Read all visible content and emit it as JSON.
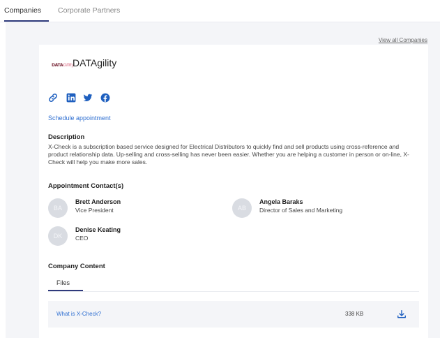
{
  "tabs": {
    "companies": "Companies",
    "corporate_partners": "Corporate Partners",
    "active": "Companies"
  },
  "view_all_link": "View all Companies",
  "company": {
    "logo_text": "DATA",
    "logo_swoosh": "Gility",
    "name": "DATAgility",
    "social_icons": [
      "link-icon",
      "linkedin-icon",
      "twitter-icon",
      "facebook-icon"
    ],
    "schedule_link": "Schedule appointment"
  },
  "description": {
    "title": "Description",
    "text": "X-Check is a subscription based service designed for Electrical Distributors to quickly find and sell products using cross-reference and product relationship data. Up-selling and cross-selling has never been easier. Whether you are helping a customer in person or on-line, X-Check will help you make more sales."
  },
  "contacts": {
    "title": "Appointment Contact(s)",
    "items": [
      {
        "initials": "BA",
        "name": "Brett Anderson",
        "role": "Vice President"
      },
      {
        "initials": "AB",
        "name": "Angela Baraks",
        "role": "Director of Sales and Marketing"
      },
      {
        "initials": "DK",
        "name": "Denise Keating",
        "role": "CEO"
      }
    ]
  },
  "company_content": {
    "title": "Company Content",
    "tab": "Files",
    "files": [
      {
        "name": "What is X-Check?",
        "size": "338 KB",
        "icon": "download-icon"
      }
    ]
  },
  "colors": {
    "accent": "#2f3a7c",
    "link": "#2f6fd1",
    "icon_blue": "#1e5fbf",
    "background": "#f4f5f8"
  }
}
